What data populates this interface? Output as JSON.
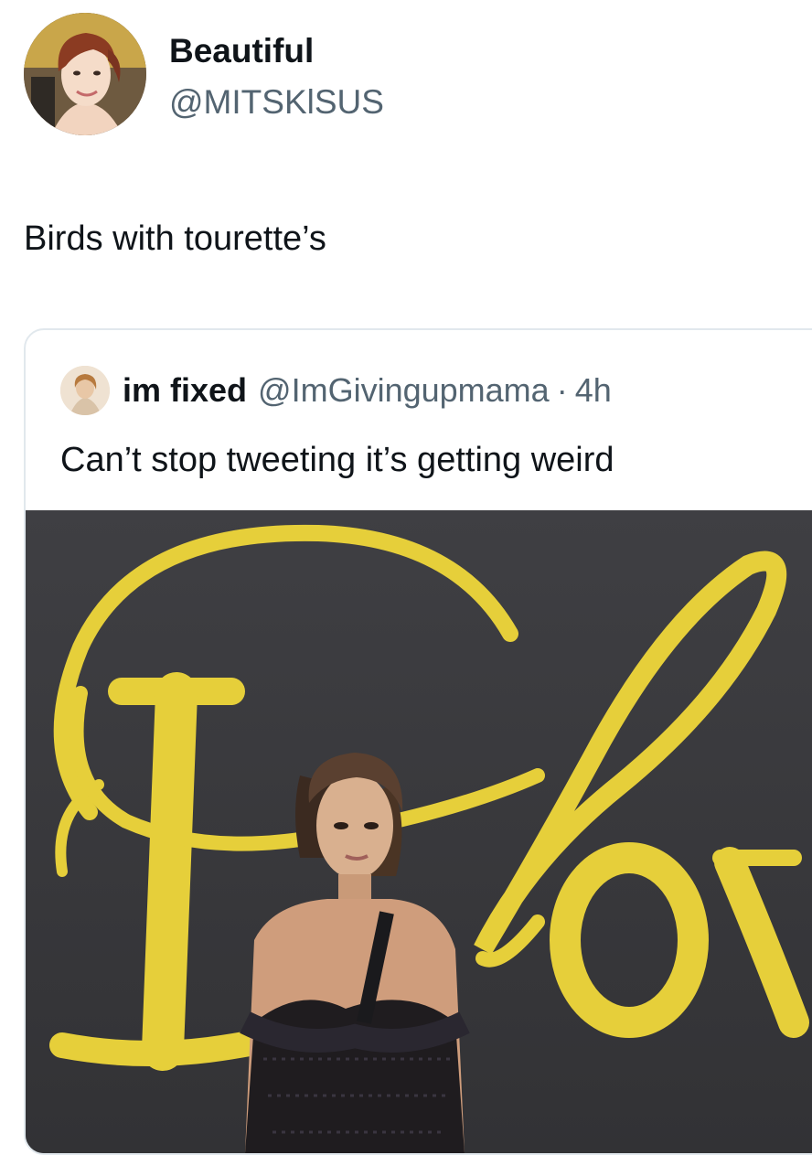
{
  "tweet": {
    "display_name": "Beautiful",
    "handle": "@MITSKlSUS",
    "text": "Birds with tourette’s",
    "avatar_icon": "avatar-photo"
  },
  "quoted_tweet": {
    "display_name": "im fixed",
    "handle": "@ImGivingupmama",
    "separator": "·",
    "time": "4h",
    "text": "Can’t stop tweeting it’s getting weird",
    "avatar_icon": "avatar-photo"
  },
  "colors": {
    "text_primary": "#0f1419",
    "text_secondary": "#536471",
    "card_border": "#e1e8ed",
    "backdrop": "#3b3b3e",
    "backdrop_script": "#e6cf3a"
  }
}
